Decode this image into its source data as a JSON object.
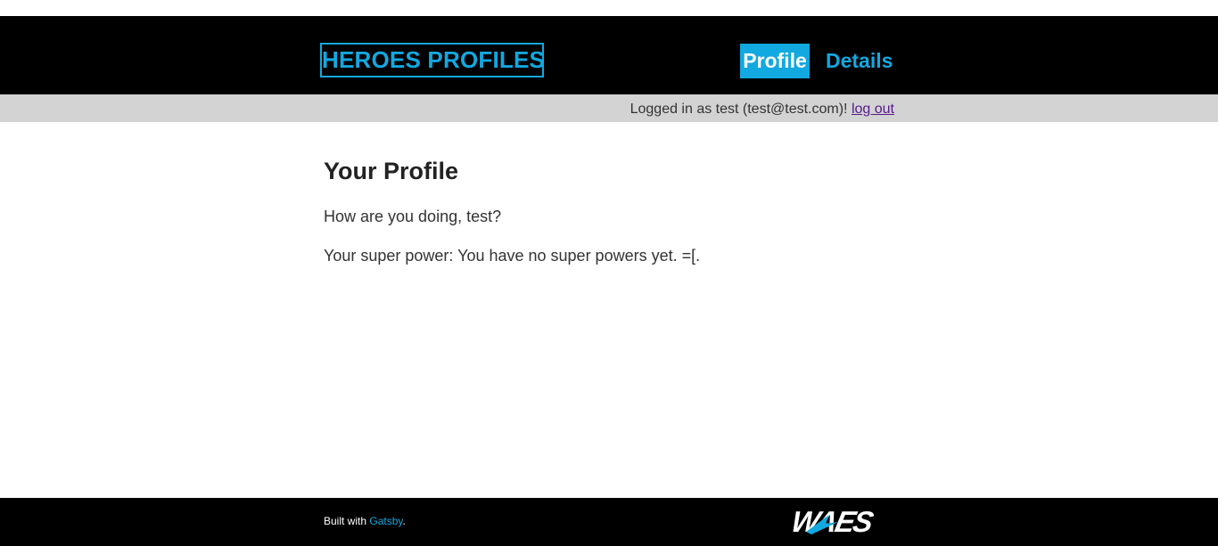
{
  "header": {
    "logo_text": "HEROES PROFILES",
    "nav": {
      "profile_label": "Profile",
      "details_label": "Details"
    }
  },
  "status": {
    "logged_in_text": "Logged in as test (test@test.com)! ",
    "logout_label": "log out"
  },
  "main": {
    "title": "Your Profile",
    "greeting": "How are you doing, test?",
    "super_power": "Your super power: You have no super powers yet. =[."
  },
  "footer": {
    "built_with_prefix": "Built with ",
    "gatsby_label": "Gatsby",
    "built_with_suffix": ".",
    "brand_logo_text": "WAES"
  },
  "colors": {
    "accent": "#12a8e0",
    "header_bg": "#000000",
    "status_bg": "#d3d3d3",
    "visited_link": "#551a8b"
  },
  "icons": {
    "footer_logo": "waes-logo"
  }
}
